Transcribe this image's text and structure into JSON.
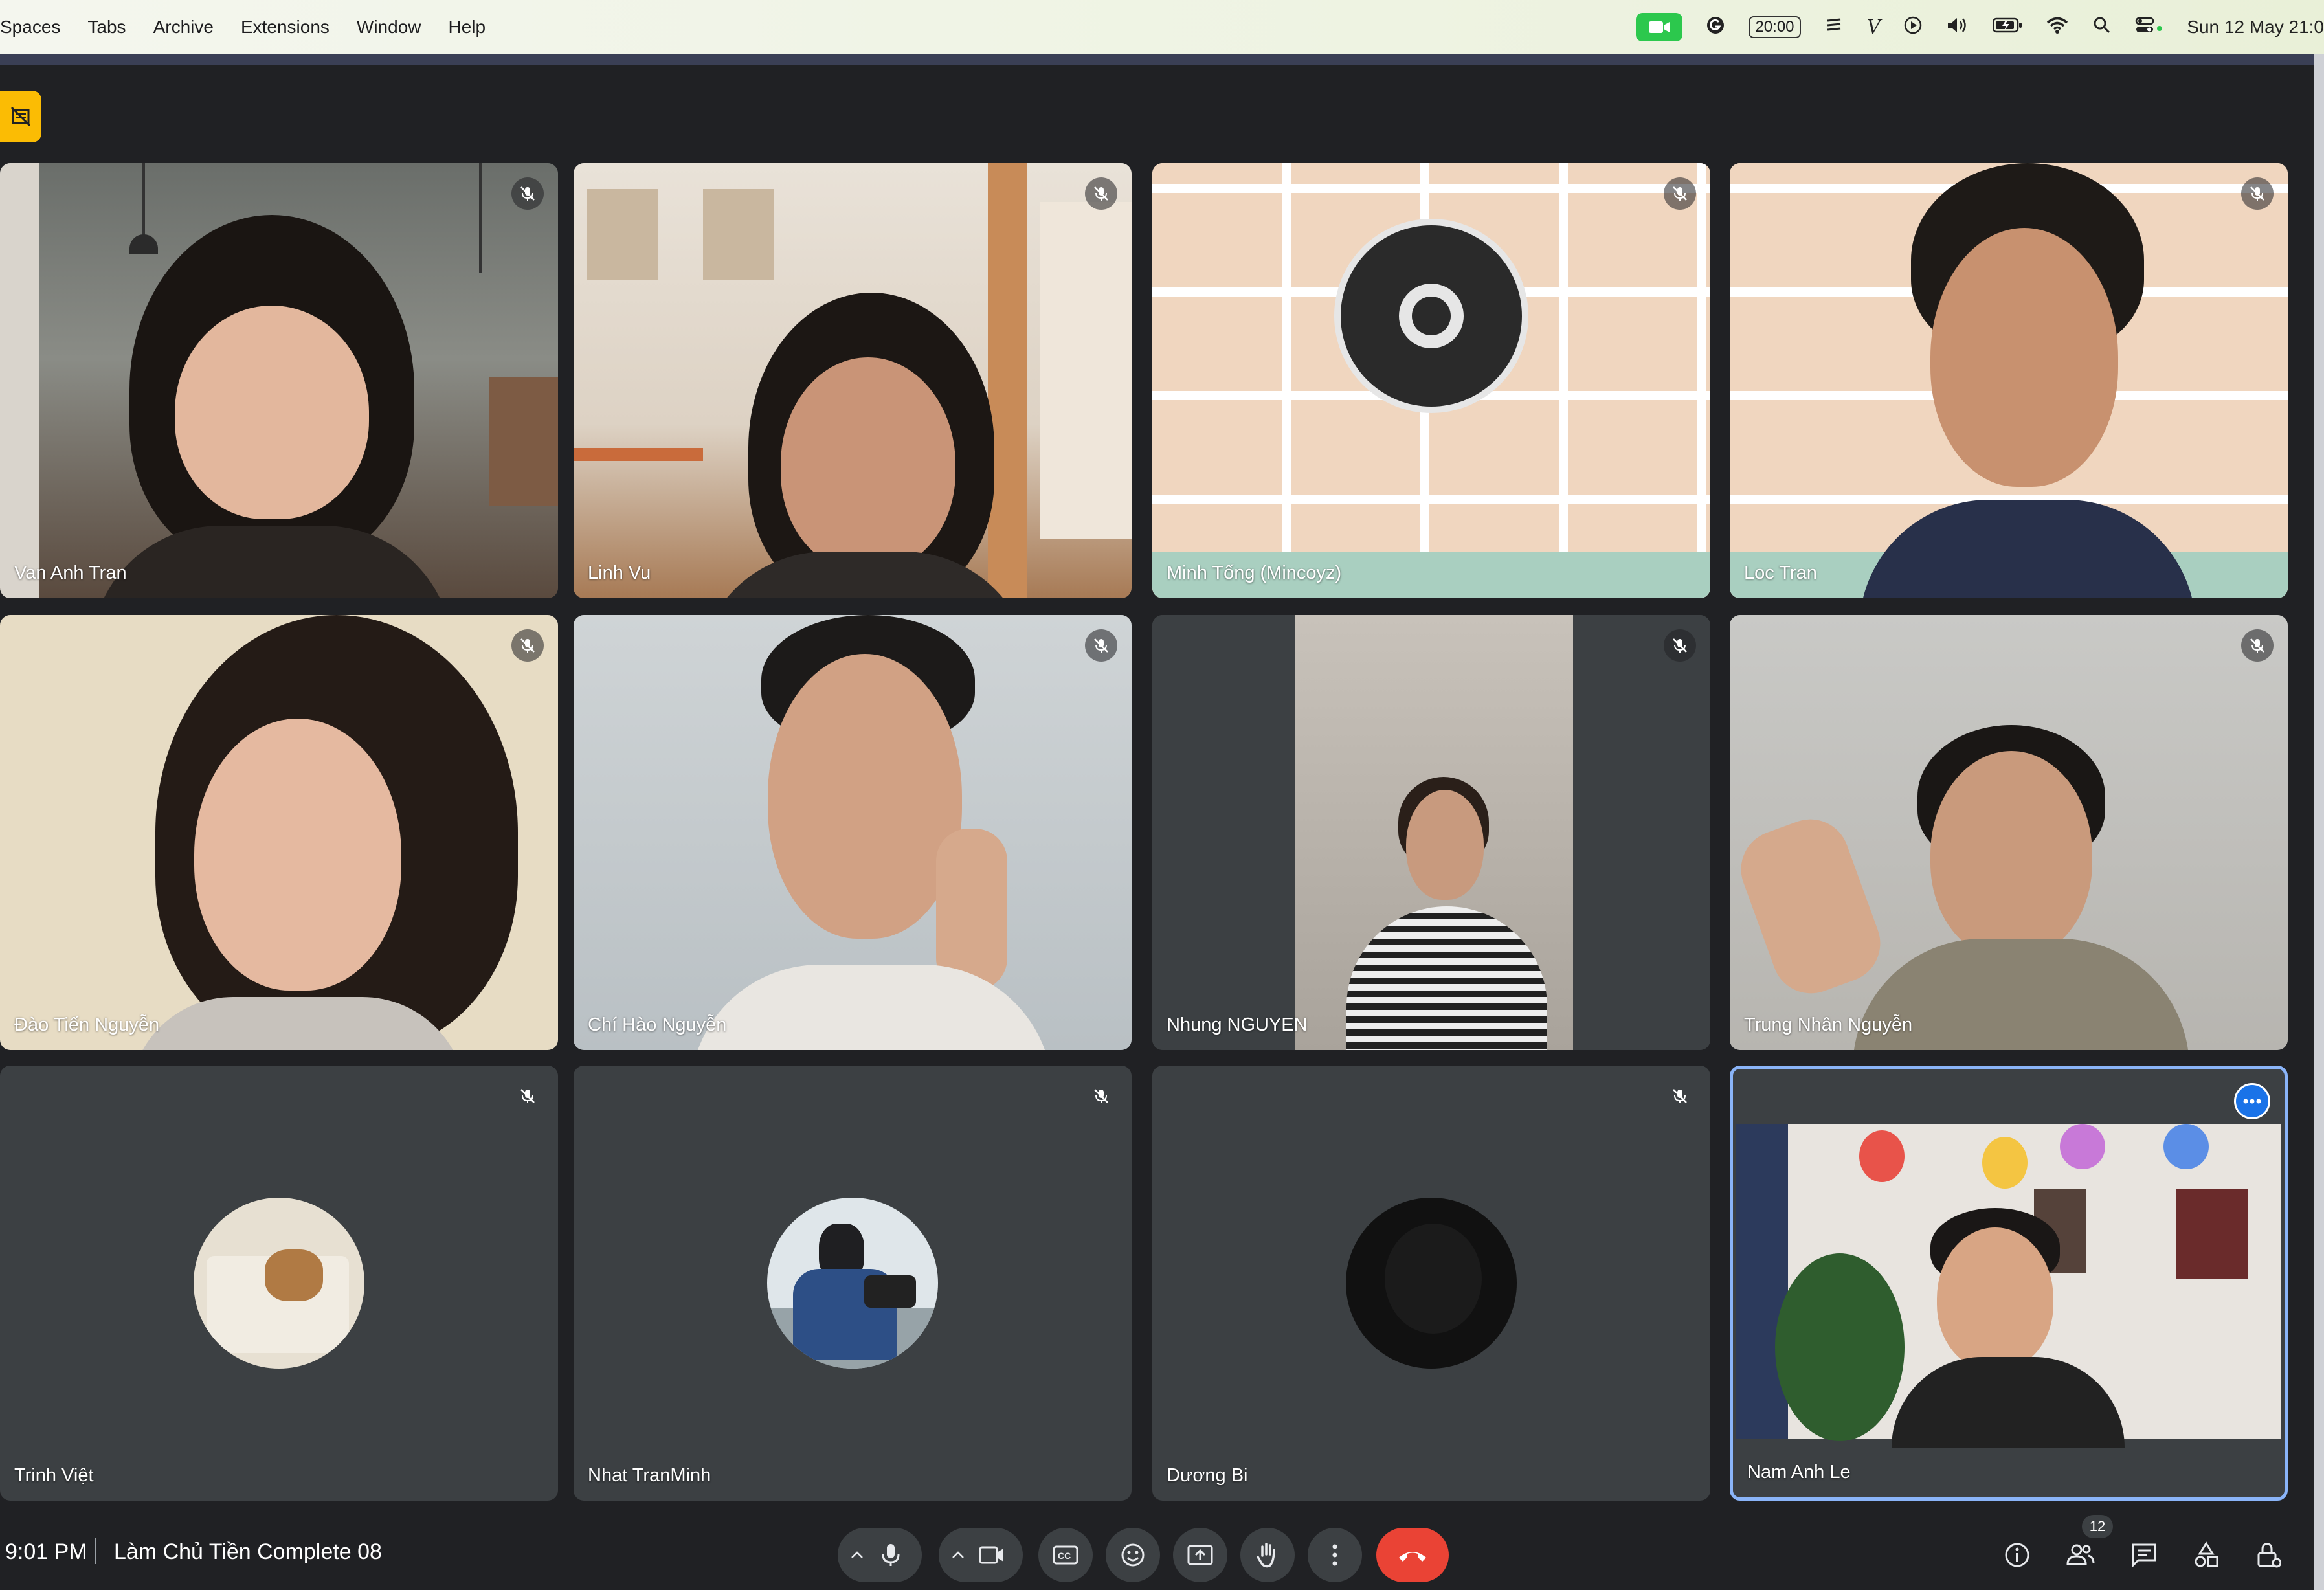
{
  "menubar": {
    "items": [
      "Spaces",
      "Tabs",
      "Archive",
      "Extensions",
      "Window",
      "Help"
    ],
    "status_time_pill": "20:00",
    "clock": "Sun 12 May  21:0"
  },
  "tiles": [
    {
      "name": "Van Anh Tran"
    },
    {
      "name": "Linh Vu"
    },
    {
      "name": "Minh Tống (Mincoyz)"
    },
    {
      "name": "Loc Tran"
    },
    {
      "name": "Đào Tiến Nguyễn"
    },
    {
      "name": "Chí Hào Nguyễn"
    },
    {
      "name": "Nhung NGUYEN"
    },
    {
      "name": "Trung Nhân Nguyễn"
    },
    {
      "name": "Trinh Việt"
    },
    {
      "name": "Nhat TranMinh"
    },
    {
      "name": "Dương Bi"
    },
    {
      "name": "Nam Anh Le"
    }
  ],
  "bottombar": {
    "time": "9:01 PM",
    "meeting_title": "Làm Chủ Tiền Complete 08",
    "people_count": "12"
  },
  "colors": {
    "background": "#202124",
    "tile": "#3c4043",
    "end_call": "#ea4335",
    "active_speaker": "#8ab4f8",
    "meet_badge": "#2cc84d"
  },
  "icons": [
    "video-camera-icon",
    "g-icon",
    "stripe-icon",
    "v-icon",
    "play-icon",
    "speaker-icon",
    "battery-icon",
    "wifi-icon",
    "search-icon",
    "control-center-icon",
    "mic-off-icon",
    "mic-icon",
    "camera-icon",
    "captions-icon",
    "emoji-icon",
    "present-icon",
    "raise-hand-icon",
    "more-options-icon",
    "end-call-icon",
    "info-icon",
    "people-icon",
    "chat-icon",
    "activities-icon",
    "host-controls-icon"
  ]
}
